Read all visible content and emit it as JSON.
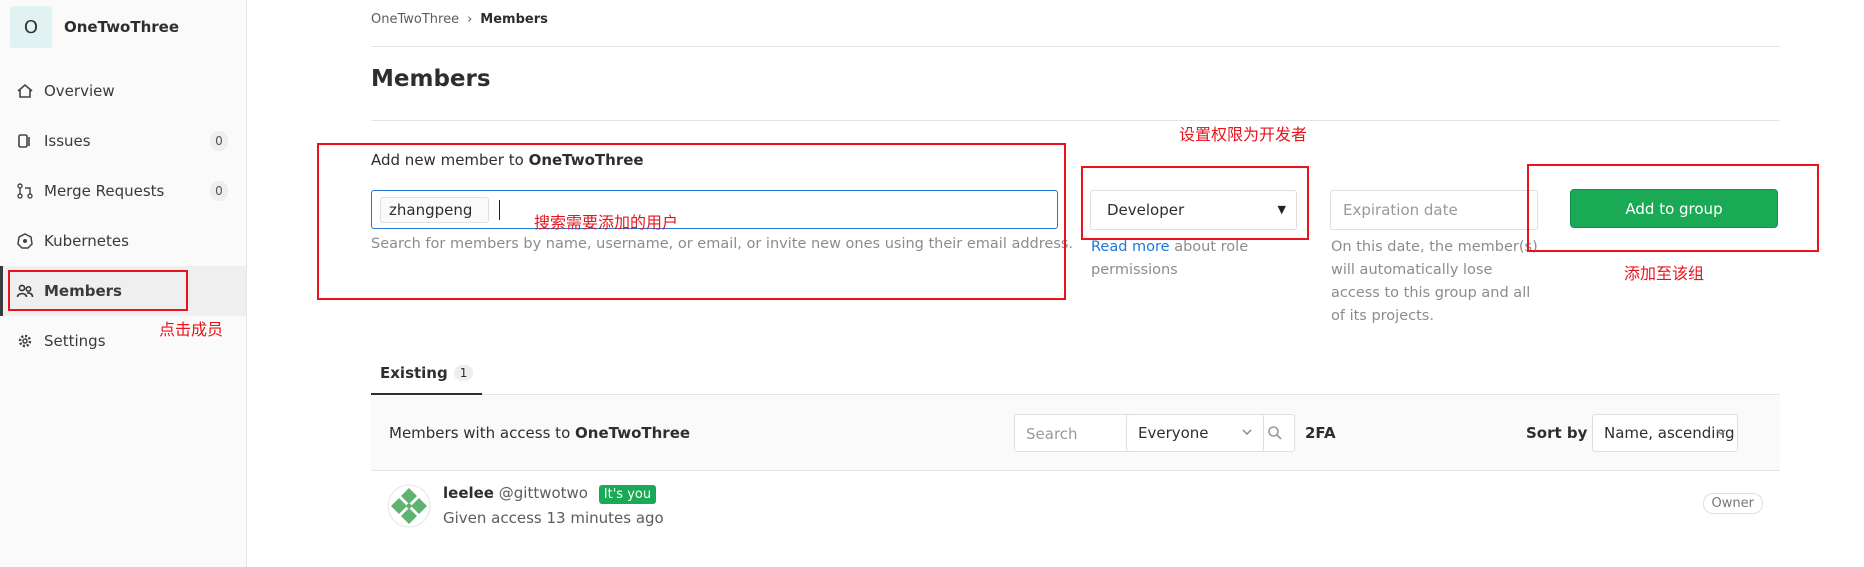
{
  "sidebar": {
    "group_initial": "O",
    "group_name": "OneTwoThree",
    "items": [
      {
        "label": "Overview",
        "icon": "home-icon"
      },
      {
        "label": "Issues",
        "icon": "issues-icon",
        "count": "0"
      },
      {
        "label": "Merge Requests",
        "icon": "merge-request-icon",
        "count": "0"
      },
      {
        "label": "Kubernetes",
        "icon": "kubernetes-icon"
      },
      {
        "label": "Members",
        "icon": "members-icon",
        "active": true
      },
      {
        "label": "Settings",
        "icon": "gear-icon"
      }
    ]
  },
  "breadcrumb": {
    "parent": "OneTwoThree",
    "current": "Members"
  },
  "page": {
    "title": "Members"
  },
  "add_member": {
    "label_prefix": "Add new member to",
    "group_name": "OneTwoThree",
    "token": "zhangpeng",
    "help": "Search for members by name, username, or email, or invite new ones using their email address.",
    "role": "Developer",
    "role_help_link": "Read more",
    "role_help_rest": " about role permissions",
    "expiration_placeholder": "Expiration date",
    "expiration_help": "On this date, the member(s) will automatically lose access to this group and all of its projects.",
    "add_button": "Add to group"
  },
  "tabs": [
    {
      "label": "Existing",
      "count": "1"
    }
  ],
  "members_bar": {
    "label_prefix": "Members with access to",
    "group_name": "OneTwoThree",
    "search_placeholder": "Search",
    "twofa_label": "2FA",
    "twofa_value": "Everyone",
    "sort_label": "Sort by",
    "sort_value": "Name, ascending"
  },
  "members": [
    {
      "name": "leelee",
      "handle": "@gittwotwo",
      "badge": "It's you",
      "access": "Given access 13 minutes ago",
      "role": "Owner"
    }
  ],
  "annotations": {
    "search_user": "搜索需要添加的用户",
    "set_role": "设置权限为开发者",
    "add_group": "添加至该组",
    "click_members": "点击成员"
  },
  "colors": {
    "accent": "#1aaa55",
    "link": "#1f78d1",
    "annotation": "#e8141c"
  }
}
